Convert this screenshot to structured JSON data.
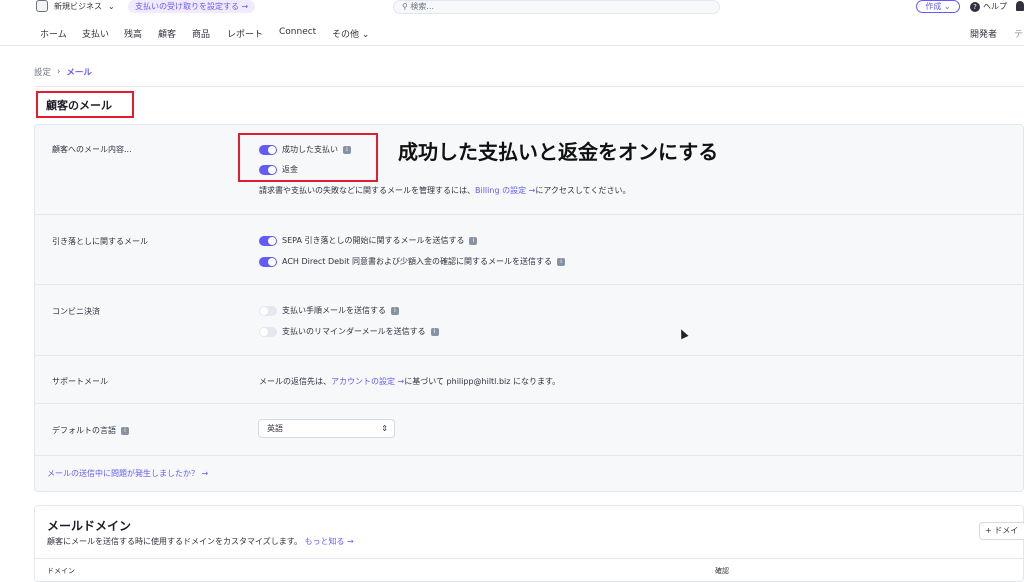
{
  "topbar": {
    "account_name": "新規ビジネス",
    "promo": "支払いの受け取りを設定する →",
    "search_placeholder": "検索...",
    "create": "作成",
    "help": "ヘルプ"
  },
  "nav": {
    "items": [
      "ホーム",
      "支払い",
      "残高",
      "顧客",
      "商品",
      "レポート",
      "Connect",
      "その他"
    ],
    "right": [
      "開発者",
      "テ"
    ]
  },
  "breadcrumb": {
    "parent": "設定",
    "current": "メール"
  },
  "page_title": "顧客のメール",
  "annotation": "成功した支払いと返金をオンにする",
  "sections": {
    "customer_email": {
      "label": "顧客へのメール内容...",
      "options": [
        "成功した支払い",
        "返金"
      ],
      "desc_prefix": "請求書や支払いの失敗などに関するメールを管理するには、",
      "desc_link": "Billing の設定 →",
      "desc_suffix": "にアクセスしてください。"
    },
    "debit": {
      "label": "引き落としに関するメール",
      "options": [
        "SEPA 引き落としの開始に関するメールを送信する",
        "ACH Direct Debit 同意書および少額入金の確認に関するメールを送信する"
      ]
    },
    "konbini": {
      "label": "コンビニ決済",
      "options": [
        "支払い手順メールを送信する",
        "支払いのリマインダーメールを送信する"
      ]
    },
    "support": {
      "label": "サポートメール",
      "desc_prefix": "メールの返信先は、",
      "desc_link": "アカウントの設定 →",
      "desc_suffix": "に基づいて philipp@hiltl.biz になります。"
    },
    "language": {
      "label": "デフォルトの言語",
      "value": "英語"
    }
  },
  "problem_link": "メールの送信中に問題が発生しましたか？ →",
  "domain": {
    "title": "メールドメイン",
    "desc": "顧客にメールを送信する時に使用するドメインをカスタマイズします。",
    "learn_more": "もっと知る →",
    "add_button": "+ ドメイ",
    "columns": [
      "ドメイン",
      "確認"
    ]
  },
  "colors": {
    "accent": "#635bff",
    "annotation_red": "#e11d2f"
  }
}
